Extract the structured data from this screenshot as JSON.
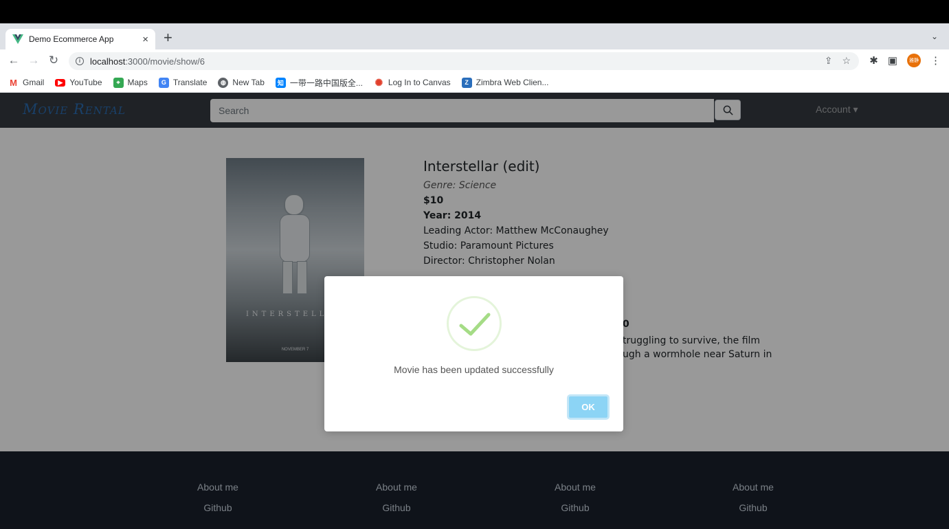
{
  "browser": {
    "tab_title": "Demo Ecommerce App",
    "url_host": "localhost",
    "url_path": ":3000/movie/show/6",
    "profile_label": "雅静"
  },
  "bookmarks": [
    {
      "label": "Gmail",
      "icon": "gmail-icon",
      "color": "#ea4335"
    },
    {
      "label": "YouTube",
      "icon": "youtube-icon",
      "color": "#ff0000"
    },
    {
      "label": "Maps",
      "icon": "maps-icon",
      "color": "#34a853"
    },
    {
      "label": "Translate",
      "icon": "translate-icon",
      "color": "#4285f4"
    },
    {
      "label": "New Tab",
      "icon": "globe-icon",
      "color": "#5f6368"
    },
    {
      "label": "一带一路中国版全...",
      "icon": "zhihu-icon",
      "color": "#0084ff"
    },
    {
      "label": "Log In to Canvas",
      "icon": "canvas-icon",
      "color": "#e13f2b"
    },
    {
      "label": "Zimbra Web Clien...",
      "icon": "zimbra-icon",
      "color": "#2a6ebb"
    }
  ],
  "app": {
    "brand": "Movie Rental",
    "search_placeholder": "Search",
    "account_label": "Account ▾"
  },
  "movie": {
    "title": "Interstellar (edit)",
    "genre": "Genre: Science",
    "price": "$10",
    "year": "Year: 2014",
    "actor": "Leading Actor: Matthew McConaughey",
    "studio": "Studio: Paramount Pictures",
    "director": "Director: Christopher Nolan",
    "partial_bold": "0",
    "desc_line1": "truggling to survive, the film",
    "desc_line2": "ugh a wormhole near Saturn in",
    "poster_title": "INTERSTELLAR",
    "poster_date": "NOVEMBER 7"
  },
  "footer": {
    "columns": [
      {
        "about": "About me",
        "github": "Github"
      },
      {
        "about": "About me",
        "github": "Github"
      },
      {
        "about": "About me",
        "github": "Github"
      },
      {
        "about": "About me",
        "github": "Github"
      }
    ]
  },
  "modal": {
    "message": "Movie has been updated successfully",
    "ok_label": "OK",
    "check_color": "#a5dc86"
  }
}
